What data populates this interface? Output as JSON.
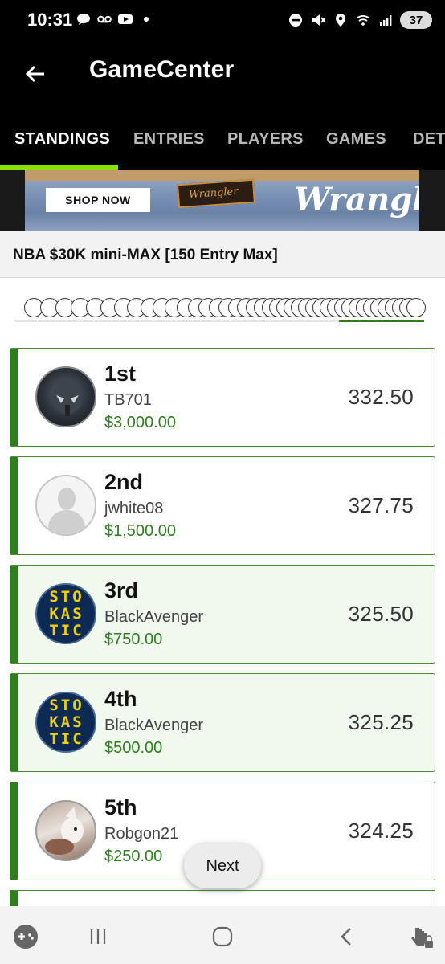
{
  "status_bar": {
    "time": "10:31",
    "battery": "37"
  },
  "app_bar": {
    "title": "GameCenter",
    "back_icon": "arrow-left-icon"
  },
  "tabs": [
    {
      "label": "STANDINGS",
      "active": true
    },
    {
      "label": "ENTRIES",
      "active": false
    },
    {
      "label": "PLAYERS",
      "active": false
    },
    {
      "label": "GAMES",
      "active": false
    },
    {
      "label": "DETA",
      "active": false
    }
  ],
  "banner": {
    "button_label": "SHOP NOW",
    "brand": "Wrangler",
    "patch": "Wrangler"
  },
  "contest": {
    "title": "NBA $30K mini-MAX [150 Entry Max]"
  },
  "entries": [
    {
      "rank": "1st",
      "user": "TB701",
      "prize": "$3,000.00",
      "score": "332.50",
      "avatar": "mask"
    },
    {
      "rank": "2nd",
      "user": "jwhite08",
      "prize": "$1,500.00",
      "score": "327.75",
      "avatar": "default"
    },
    {
      "rank": "3rd",
      "user": "BlackAvenger",
      "prize": "$750.00",
      "score": "325.50",
      "avatar": "stokastic"
    },
    {
      "rank": "4th",
      "user": "BlackAvenger",
      "prize": "$500.00",
      "score": "325.25",
      "avatar": "stokastic"
    },
    {
      "rank": "5th",
      "user": "Robgon21",
      "prize": "$250.00",
      "score": "324.25",
      "avatar": "dog"
    }
  ],
  "stokastic_logo": "STOKASTIC",
  "next_button": "Next",
  "colors": {
    "accent_green": "#2e7d1e",
    "tab_indicator": "#8ee000",
    "highlight_bg": "#f1f8ee"
  }
}
